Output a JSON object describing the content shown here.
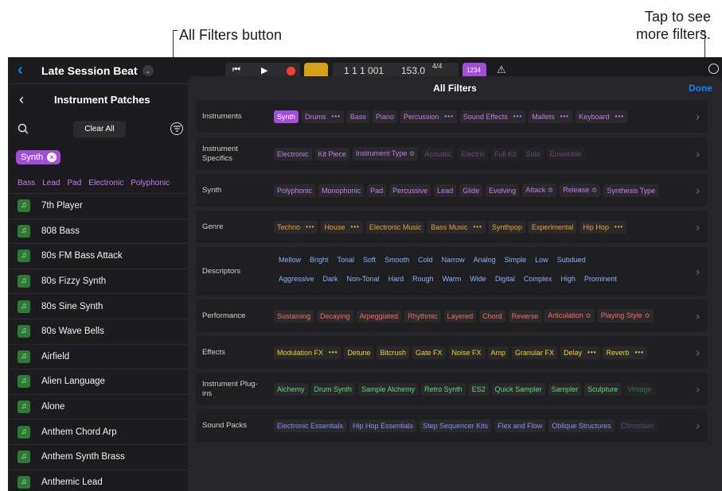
{
  "callouts": {
    "all_filters": "All Filters button",
    "tap_line1": "Tap to see",
    "tap_line2": "more filters."
  },
  "header": {
    "project_title": "Late Session Beat",
    "counter": "1 1 1 001",
    "tempo": "153.0",
    "timesig_top": "4/4",
    "key_label": "1234"
  },
  "left_panel": {
    "title": "Instrument Patches",
    "clear_all": "Clear All",
    "active_chip": "Synth",
    "tags": [
      "Bass",
      "Lead",
      "Pad",
      "Electronic",
      "Polyphonic"
    ],
    "patches": [
      "7th Player",
      "808 Bass",
      "80s FM Bass Attack",
      "80s Fizzy Synth",
      "80s Sine Synth",
      "80s Wave Bells",
      "Airfield",
      "Alien Language",
      "Alone",
      "Anthem Chord Arp",
      "Anthem Synth Brass",
      "Anthemic Lead"
    ]
  },
  "modal": {
    "title": "All Filters",
    "done": "Done"
  },
  "colors": {
    "purple": "#c67cf0",
    "purple_active": "#a34ed8",
    "orange": "#f0a332",
    "blue": "#8ab0ff",
    "red": "#ff6b5e",
    "yellow": "#f0d020",
    "green": "#5ed97c",
    "indigo": "#8b8cf8"
  },
  "rows": [
    {
      "label": "Instruments",
      "color": "#c67cf0",
      "chips": [
        {
          "t": "Synth",
          "active": true
        },
        {
          "t": "Drums",
          "dots": true
        },
        {
          "t": "Bass"
        },
        {
          "t": "Piano"
        },
        {
          "t": "Percussion",
          "dots": true
        },
        {
          "t": "Sound Effects",
          "dots": true
        },
        {
          "t": "Mallets",
          "dots": true
        },
        {
          "t": "Keyboard",
          "dots": true
        }
      ]
    },
    {
      "label": "Instrument Specifics",
      "color": "#c67cf0",
      "chips": [
        {
          "t": "Electronic"
        },
        {
          "t": "Kit Piece"
        },
        {
          "t": "Instrument Type ≎"
        },
        {
          "t": "Acoustic",
          "off": true
        },
        {
          "t": "Electric",
          "off": true
        },
        {
          "t": "Full Kit",
          "off": true
        },
        {
          "t": "Solo",
          "off": true
        },
        {
          "t": "Ensemble",
          "off": true
        }
      ]
    },
    {
      "label": "Synth",
      "color": "#c67cf0",
      "chips": [
        {
          "t": "Polyphonic"
        },
        {
          "t": "Monophonic"
        },
        {
          "t": "Pad"
        },
        {
          "t": "Percussive"
        },
        {
          "t": "Lead"
        },
        {
          "t": "Glide"
        },
        {
          "t": "Evolving"
        },
        {
          "t": "Attack ≎"
        },
        {
          "t": "Release ≎"
        },
        {
          "t": "Synthesis Type"
        }
      ]
    },
    {
      "label": "Genre",
      "color": "#f0a332",
      "chips": [
        {
          "t": "Techno",
          "dots": true
        },
        {
          "t": "House",
          "dots": true
        },
        {
          "t": "Electronic Music"
        },
        {
          "t": "Bass Music",
          "dots": true
        },
        {
          "t": "Synthpop"
        },
        {
          "t": "Experimental"
        },
        {
          "t": "Hip Hop",
          "dots": true
        }
      ]
    },
    {
      "label": "Descriptors",
      "color": "#8ab0ff",
      "line1": [
        "Mellow",
        "Bright",
        "Tonal",
        "Soft",
        "Smooth",
        "Cold",
        "Narrow",
        "Analog",
        "Simple",
        "Low",
        "Subdued"
      ],
      "line2": [
        "Aggressive",
        "Dark",
        "Non-Tonal",
        "Hard",
        "Rough",
        "Warm",
        "Wide",
        "Digital",
        "Complex",
        "High",
        "Prominent"
      ]
    },
    {
      "label": "Performance",
      "color": "#ff6b5e",
      "chips": [
        {
          "t": "Sustaining"
        },
        {
          "t": "Decaying"
        },
        {
          "t": "Arpeggiated"
        },
        {
          "t": "Rhythmic"
        },
        {
          "t": "Layered"
        },
        {
          "t": "Chord"
        },
        {
          "t": "Reverse"
        },
        {
          "t": "Articulation ≎"
        },
        {
          "t": "Playing Style ≎"
        }
      ]
    },
    {
      "label": "Effects",
      "color": "#f0d020",
      "chips": [
        {
          "t": "Modulation FX",
          "dots": true
        },
        {
          "t": "Detune"
        },
        {
          "t": "Bitcrush"
        },
        {
          "t": "Gate FX"
        },
        {
          "t": "Noise FX"
        },
        {
          "t": "Amp"
        },
        {
          "t": "Granular FX"
        },
        {
          "t": "Delay",
          "dots": true
        },
        {
          "t": "Reverb",
          "dots": true
        }
      ]
    },
    {
      "label": "Instrument Plug-ins",
      "color": "#5ed97c",
      "chips": [
        {
          "t": "Alchemy"
        },
        {
          "t": "Drum Synth"
        },
        {
          "t": "Sample Alchemy"
        },
        {
          "t": "Retro Synth"
        },
        {
          "t": "ES2"
        },
        {
          "t": "Quick Sampler"
        },
        {
          "t": "Sampler"
        },
        {
          "t": "Sculpture"
        },
        {
          "t": "Vintage",
          "off": true
        }
      ]
    },
    {
      "label": "Sound Packs",
      "color": "#8b8cf8",
      "chips": [
        {
          "t": "Electronic Essentials"
        },
        {
          "t": "Hip Hop Essentials"
        },
        {
          "t": "Step Sequencer Kits"
        },
        {
          "t": "Flex and Flow"
        },
        {
          "t": "Oblique Structures"
        },
        {
          "t": "Chromium",
          "off": true
        }
      ]
    }
  ]
}
